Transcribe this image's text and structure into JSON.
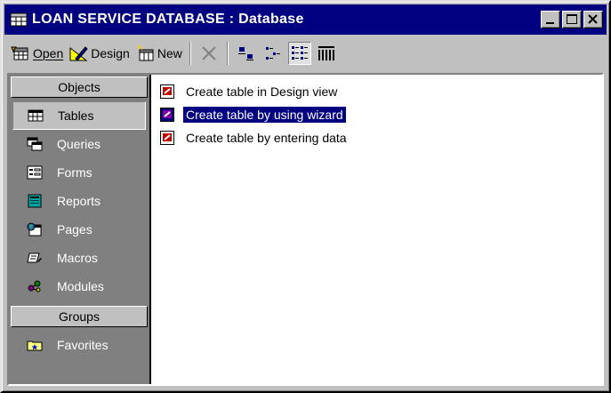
{
  "window": {
    "title": "LOAN SERVICE DATABASE : Database"
  },
  "toolbar": {
    "open_label": "Open",
    "design_label": "Design",
    "new_label": "New"
  },
  "objects_bar": {
    "header": "Objects",
    "items": [
      {
        "label": "Tables",
        "icon": "table-icon"
      },
      {
        "label": "Queries",
        "icon": "query-icon"
      },
      {
        "label": "Forms",
        "icon": "form-icon"
      },
      {
        "label": "Reports",
        "icon": "report-icon"
      },
      {
        "label": "Pages",
        "icon": "page-icon"
      },
      {
        "label": "Macros",
        "icon": "macro-icon"
      },
      {
        "label": "Modules",
        "icon": "module-icon"
      }
    ],
    "groups_header": "Groups",
    "groups": [
      {
        "label": "Favorites",
        "icon": "favorites-icon"
      }
    ]
  },
  "list": {
    "items": [
      {
        "label": "Create table in Design view"
      },
      {
        "label": "Create table by using wizard"
      },
      {
        "label": "Create table by entering data"
      }
    ]
  },
  "colors": {
    "titlebar": "#000080",
    "face": "#c0c0c0",
    "objbar": "#808080",
    "selection": "#000080"
  }
}
